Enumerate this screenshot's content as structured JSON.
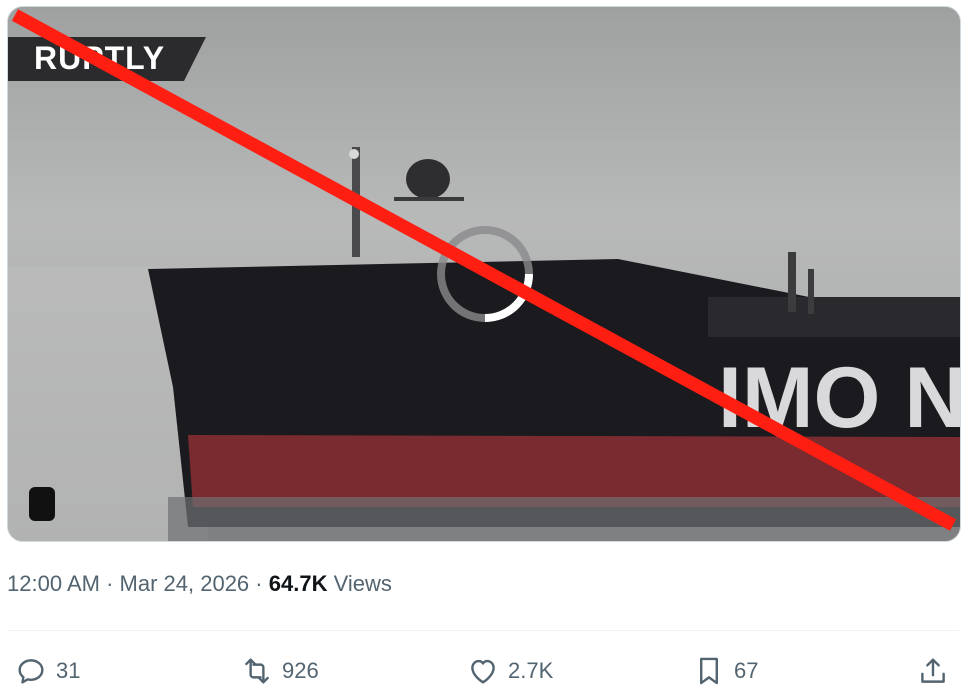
{
  "video": {
    "watermark": "RUPTLY",
    "hull_text": "IMO N"
  },
  "meta": {
    "time": "12:00 AM",
    "sep1": "·",
    "date": "Mar 24, 2026",
    "sep2": "·",
    "views_count": "64.7K",
    "views_label": "Views"
  },
  "actions": {
    "replies": "31",
    "reposts": "926",
    "likes": "2.7K",
    "bookmarks": "67"
  },
  "colors": {
    "cross": "#ff1e12",
    "hull_red": "#7a2b30",
    "hull_dark": "#1b1b1f",
    "text_secondary": "#536471"
  }
}
